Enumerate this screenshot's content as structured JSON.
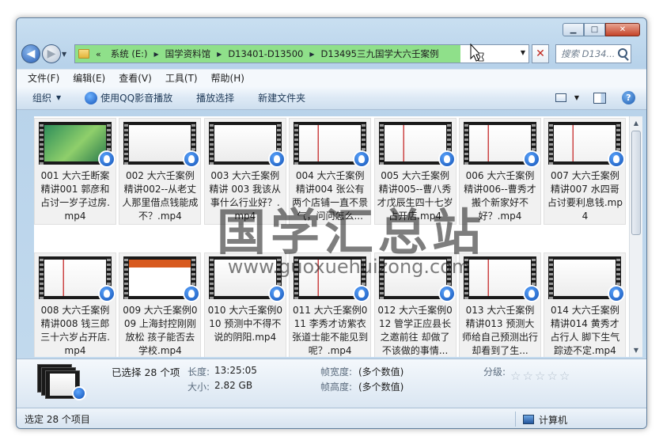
{
  "window": {
    "caption_buttons": [
      "minimize-icon",
      "maximize-icon",
      "close-icon"
    ]
  },
  "address": {
    "lead": "«",
    "crumbs": [
      "系统 (E:)",
      "国学资料馆",
      "D13401-D13500",
      "D13495三九国学大六壬案例"
    ],
    "load_progress": 0.85,
    "progress_color": "#8fe08a"
  },
  "search": {
    "placeholder": "搜索 D134..."
  },
  "menu": [
    "文件(F)",
    "编辑(E)",
    "查看(V)",
    "工具(T)",
    "帮助(H)"
  ],
  "toolbar": {
    "organize": "组织",
    "play_qq": "使用QQ影音播放",
    "play_selected": "播放选择",
    "new_folder": "新建文件夹"
  },
  "files": [
    "001 大六壬断案精讲001 郭彦和占讨一岁子过房.mp4",
    "002 大六壬案例精讲002--从老丈人那里借点钱能成不？.mp4",
    "003 大六壬案例精讲 003 我该从事什么行业好？.mp4",
    "004 大六壬案例精讲004 张公有两个店铺一直不景气，问问怎么...",
    "005 大六壬案例精讲005--曹八秀才戊辰生四十七岁占开店.mp4",
    "006 大六壬案例精讲006--曹秀才搬个新家好不好？.mp4",
    "007 大六壬案例精讲007 水四哥占讨要利息钱.mp4",
    "008 大六壬案例精讲008 钱三郎三十六岁占开店.mp4",
    "009 大六壬案例009 上海封控刚刚放松 孩子能否去学校.mp4",
    "010 大六壬案例010 预测中不得不说的阴阳.mp4",
    "011 大六壬案例011 李秀才访紫衣张道士能不能见到呢？.mp4",
    "012 大六壬案例012 管学正应县长之邀前往 却做了不该做的事情...",
    "013 大六壬案例精讲013 预测大师给自己预测出行 却看到了生...",
    "014 大六壬案例精讲014 黄秀才占行人 脚下生气踪迹不定.mp4"
  ],
  "watermark": {
    "cn": "国学汇总站",
    "url": "www.guoxuehuizong.com"
  },
  "details": {
    "selected": "已选择 28 个项",
    "length_label": "长度:",
    "length_value": "13:25:05",
    "size_label": "大小:",
    "size_value": "2.82 GB",
    "frame_width_label": "帧宽度:",
    "frame_width_value": "(多个数值)",
    "frame_height_label": "帧高度:",
    "frame_height_value": "(多个数值)",
    "rating_label": "分级:",
    "rating_stars": 0,
    "rating_max": 5
  },
  "status": {
    "left": "选定 28 个项目",
    "right": "计算机"
  }
}
